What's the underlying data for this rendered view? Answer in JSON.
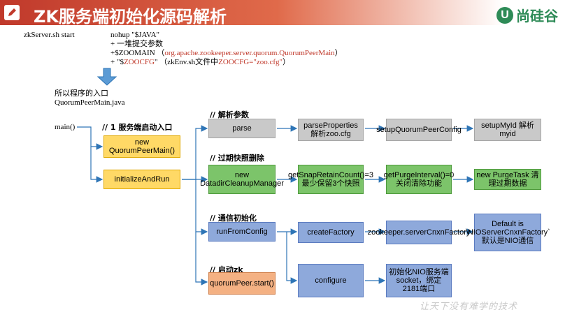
{
  "header": {
    "title": "ZK服务端初始化源码解析",
    "logo_text": "尚硅谷",
    "logo_badge": "U",
    "icon": "pencil-icon",
    "bar_color": "#c0392b"
  },
  "command": {
    "script": "zkServer.sh start",
    "lines": [
      "nohup \"$JAVA\"",
      "+ 一堆提交参数",
      "+$ZOOMAIN （",
      "org.apache.zookeeper.server.quorum.QuorumPeerMain",
      "）",
      "+ \"$",
      "ZOOCFG",
      "\" （zkEnv.sh文件中",
      "ZOOCFG=\"zoo.cfg\"",
      "）"
    ]
  },
  "entry": {
    "line1": "所以程序的入口",
    "line2": "QuorumPeerMain.java",
    "main": "main()"
  },
  "labels": {
    "startup": "// 1 服务端启动入口",
    "parse_args": "// 解析参数",
    "purge": "// 过期快照删除",
    "comm_init": "// 通信初始化",
    "start_zk": "// 启动zk"
  },
  "boxes": {
    "new_qpm": "new QuorumPeerMain()",
    "init_run": "initializeAndRun",
    "parse": "parse",
    "parse_props": "parseProperties 解析zoo.cfg",
    "setup_qpc": "setupQuorumPeerConfig",
    "setup_myid": "setupMyId 解析myid",
    "new_dcm": "new DatadirCleanupManager",
    "get_snap": "getSnapRetainCount()=3最少保留3个快照",
    "get_purge": "getPurgeInterval()=0关闭清除功能",
    "new_purge_task": "new PurgeTask 清理过期数据",
    "run_from_config": "runFromConfig",
    "create_factory": "createFactory",
    "zk_server_factory": "zookeeper.serverCnxnFactory",
    "default_nio": "Default is `NIOServerCnxnFactory` 默认是NIO通信",
    "qp_start": "quorumPeer.start()",
    "configure": "configure",
    "nio_init": "初始化NIO服务端socket，绑定2181端口"
  },
  "colors": {
    "gray": "#c9c9c9",
    "green": "#7cc46a",
    "blue": "#8ea9db",
    "yellow": "#ffd966",
    "orange": "#f4b183",
    "arrow_blue": "#2e75b6"
  },
  "watermark": "让天下没有难学的技术"
}
